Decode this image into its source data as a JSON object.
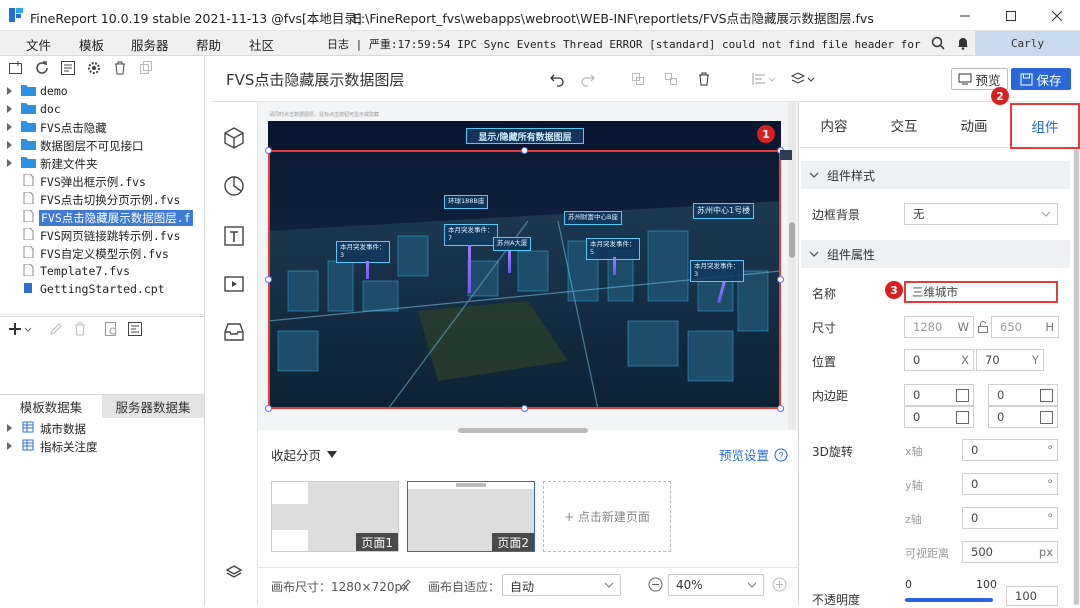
{
  "window": {
    "app_title": "FineReport 10.0.19 stable 2021-11-13 @fvs[本地目录]",
    "file_path": "E:\\FineReport_fvs\\webapps\\webroot\\WEB-INF\\reportlets/FVS点击隐藏展示数据图层.fvs"
  },
  "menu": [
    "文件",
    "模板",
    "服务器",
    "帮助",
    "社区"
  ],
  "log": "日志 | 严重:17:59:54 IPC Sync Events Thread ERROR [standard] could not find file header for file:...",
  "user": "Carly",
  "tree": [
    {
      "label": "demo",
      "type": "folder"
    },
    {
      "label": "doc",
      "type": "folder"
    },
    {
      "label": "FVS点击隐藏",
      "type": "folder"
    },
    {
      "label": "数据图层不可见接口",
      "type": "folder"
    },
    {
      "label": "新建文件夹",
      "type": "folder"
    },
    {
      "label": "FVS弹出框示例.fvs",
      "type": "file"
    },
    {
      "label": "FVS点击切换分页示例.fvs",
      "type": "file"
    },
    {
      "label": "FVS点击隐藏展示数据图层.f",
      "type": "file",
      "selected": true
    },
    {
      "label": "FVS网页链接跳转示例.fvs",
      "type": "file"
    },
    {
      "label": "FVS自定义模型示例.fvs",
      "type": "file"
    },
    {
      "label": "Template7.fvs",
      "type": "file"
    },
    {
      "label": "GettingStarted.cpt",
      "type": "cpt"
    }
  ],
  "dataset_tabs": [
    "模板数据集",
    "服务器数据集"
  ],
  "datasets": [
    "城市数据",
    "指标关注度"
  ],
  "doc": {
    "title": "FVS点击隐藏展示数据图层",
    "preview": "预览",
    "save": "保存"
  },
  "canvas": {
    "header": "显示/隐藏所有数据图层",
    "small_caption": "请同时点击数据图层，鼠标点击按钮可显示或隐藏",
    "labels": [
      "环球188B座",
      "苏州中心1号楼",
      "本月突发事件：",
      "本月突发事件：",
      "本月突发事件：",
      "本月突发事件：",
      "苏州财富中心B座",
      "苏州A大厦",
      "本月突发事件："
    ],
    "label_values": [
      "3",
      "7",
      "5",
      "3"
    ]
  },
  "badges": [
    "1",
    "2",
    "3"
  ],
  "pages": {
    "collapse": "收起分页",
    "preview_settings": "预览设置",
    "page1": "页面1",
    "page2": "页面2",
    "new_page": "+ 点击新建页面"
  },
  "status": {
    "canvas_size": "画布尺寸：1280×720px",
    "adapt_label": "画布自适应：",
    "adapt_value": "自动",
    "zoom": "40%"
  },
  "tabs": [
    "内容",
    "交互",
    "动画",
    "组件"
  ],
  "component": {
    "style_head": "组件样式",
    "border_label": "边框背景",
    "border_value": "无",
    "attr_head": "组件属性",
    "name_label": "名称",
    "name_value": "三维城市",
    "size_label": "尺寸",
    "width": "1280",
    "w_unit": "W",
    "height": "650",
    "h_unit": "H",
    "pos_label": "位置",
    "x": "0",
    "x_unit": "X",
    "y": "70",
    "y_unit": "Y",
    "padding_label": "内边距",
    "pad": [
      "0",
      "0",
      "0",
      "0"
    ],
    "rot_label": "3D旋转",
    "rx_label": "x轴",
    "rx": "0",
    "ry_label": "y轴",
    "ry": "0",
    "rz_label": "z轴",
    "rz": "0",
    "deg": "°",
    "view_label": "可视距离",
    "view": "500",
    "view_unit": "px",
    "opacity_label": "不透明度",
    "op_min": "0",
    "op_max": "100",
    "opacity": "100"
  }
}
